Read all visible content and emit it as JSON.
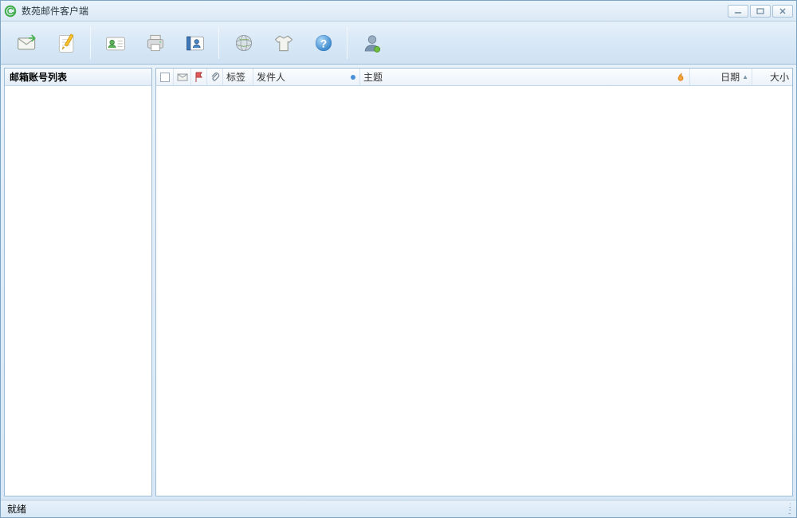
{
  "window": {
    "title": "数苑邮件客户端"
  },
  "toolbar": {
    "items": [
      {
        "name": "receive-mail",
        "icon": "envelope-in"
      },
      {
        "name": "compose-mail",
        "icon": "compose"
      },
      {
        "sep": true
      },
      {
        "name": "contacts",
        "icon": "contact-card"
      },
      {
        "name": "print",
        "icon": "printer"
      },
      {
        "name": "address-book",
        "icon": "addr-book"
      },
      {
        "sep": true
      },
      {
        "name": "web",
        "icon": "globe"
      },
      {
        "name": "skin",
        "icon": "tshirt"
      },
      {
        "name": "help",
        "icon": "help"
      },
      {
        "sep": true
      },
      {
        "name": "user",
        "icon": "user"
      }
    ]
  },
  "sidebar": {
    "header": "邮箱账号列表"
  },
  "columns": {
    "tag": "标签",
    "sender": "发件人",
    "subject": "主题",
    "date": "日期",
    "size": "大小"
  },
  "statusbar": {
    "text": "就绪"
  }
}
